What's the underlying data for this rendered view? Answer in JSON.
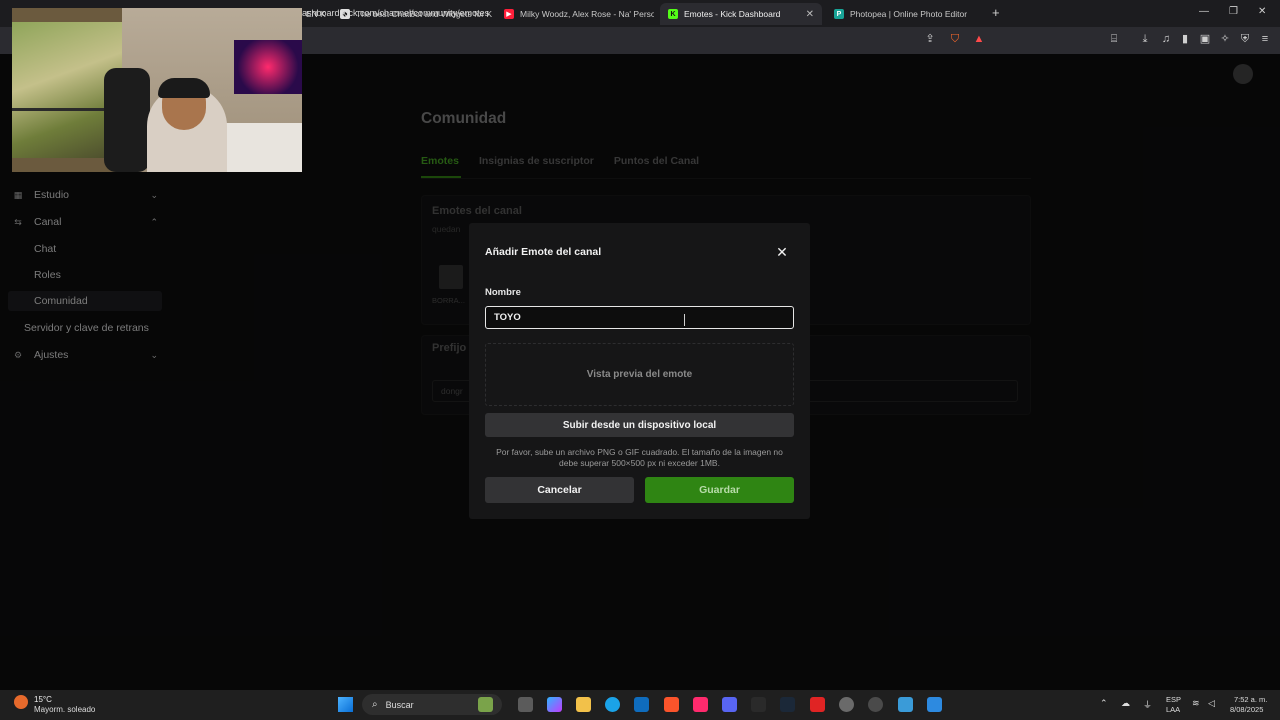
{
  "browser": {
    "tabs": [
      {
        "label": "EN K",
        "icon": "tab-icon"
      },
      {
        "label": "The best ChatBot and Widgets for Ki",
        "icon": "botrix-icon"
      },
      {
        "label": "Milky Woodz, Alex Rose - Na' Persona",
        "icon": "youtube-icon"
      },
      {
        "label": "Emotes - Kick Dashboard",
        "icon": "kick-icon",
        "close": "✕"
      },
      {
        "label": "Photopea | Online Photo Editor",
        "icon": "photopea-icon"
      }
    ],
    "new_tab": "+",
    "url": "ashboard.kick.com/channel/community/emotes",
    "window_controls": [
      "—",
      "❐",
      "✕"
    ]
  },
  "sidebar": {
    "items": [
      {
        "label": "Estudio",
        "icon": "studio-icon",
        "chevron": "⌄"
      },
      {
        "label": "Canal",
        "icon": "channel-icon",
        "chevron": "⌃"
      },
      {
        "label": "Chat"
      },
      {
        "label": "Roles"
      },
      {
        "label": "Comunidad"
      },
      {
        "label": "Servidor y clave de retrans"
      },
      {
        "label": "Ajustes",
        "icon": "gear-icon",
        "chevron": "⌄"
      }
    ]
  },
  "content": {
    "title": "Comunidad",
    "tabs": [
      "Emotes",
      "Insignias de suscriptor",
      "Puntos del Canal"
    ],
    "emotes_panel": {
      "title": "Emotes del canal",
      "subtitle": "quedan",
      "emote_label": "BORRA..."
    },
    "prefix_panel": {
      "title": "Prefijo",
      "value": "dongr"
    }
  },
  "modal": {
    "title": "Añadir Emote del canal",
    "close": "✕",
    "name_label": "Nombre",
    "name_value": "TOYO",
    "preview_label": "Vista previa del emote",
    "upload_label": "Subir desde un dispositivo local",
    "hint": "Por favor, sube un archivo PNG o GIF cuadrado. El tamaño de la imagen no debe superar 500×500 px ni exceder 1MB.",
    "cancel_label": "Cancelar",
    "save_label": "Guardar"
  },
  "colors": {
    "kick_green": "#2f8513",
    "active_tab": "#3b8a1e"
  },
  "taskbar": {
    "weather_temp": "15°C",
    "weather_desc": "Mayorm. soleado",
    "search_label": "Buscar",
    "lang": "ESP",
    "lang_region": "LAA",
    "time": "7:52 a. m.",
    "date": "8/08/2025"
  }
}
